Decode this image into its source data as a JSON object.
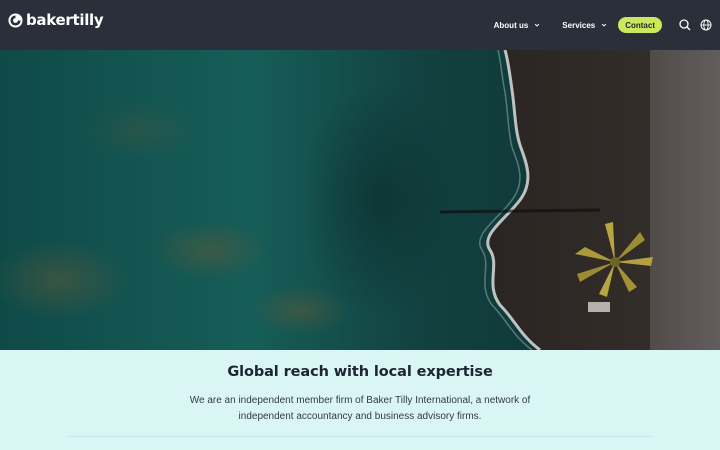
{
  "header": {
    "logo_text": "bakertilly",
    "nav": {
      "about_label": "About us",
      "services_label": "Services",
      "contact_label": "Contact"
    },
    "icons": [
      "logo-mark-icon",
      "chevron-down-icon",
      "search-icon",
      "globe-icon"
    ]
  },
  "content": {
    "title": "Global reach with local expertise",
    "description": "We are an independent member firm of Baker Tilly International, a network of independent accountancy and business advisory firms."
  },
  "colors": {
    "header_bg": "#2b2f3a",
    "accent": "#c9e95b",
    "content_bg": "#d9f6f5",
    "title": "#1e2431"
  }
}
